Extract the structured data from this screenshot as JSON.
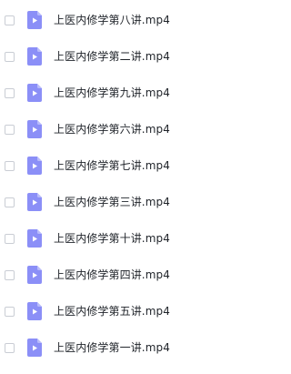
{
  "files": [
    {
      "name": "上医内修学第八讲.mp4",
      "checked": false,
      "icon": "video-file-icon"
    },
    {
      "name": "上医内修学第二讲.mp4",
      "checked": false,
      "icon": "video-file-icon"
    },
    {
      "name": "上医内修学第九讲.mp4",
      "checked": false,
      "icon": "video-file-icon"
    },
    {
      "name": "上医内修学第六讲.mp4",
      "checked": false,
      "icon": "video-file-icon"
    },
    {
      "name": "上医内修学第七讲.mp4",
      "checked": false,
      "icon": "video-file-icon"
    },
    {
      "name": "上医内修学第三讲.mp4",
      "checked": false,
      "icon": "video-file-icon"
    },
    {
      "name": "上医内修学第十讲.mp4",
      "checked": false,
      "icon": "video-file-icon"
    },
    {
      "name": "上医内修学第四讲.mp4",
      "checked": false,
      "icon": "video-file-icon"
    },
    {
      "name": "上医内修学第五讲.mp4",
      "checked": false,
      "icon": "video-file-icon"
    },
    {
      "name": "上医内修学第一讲.mp4",
      "checked": false,
      "icon": "video-file-icon"
    }
  ],
  "colors": {
    "icon_body": "#8b8ff7",
    "icon_fold": "#b9bcfb",
    "icon_play": "#ffffff",
    "checkbox_border": "#c9cdd4",
    "text": "#1f2329"
  }
}
